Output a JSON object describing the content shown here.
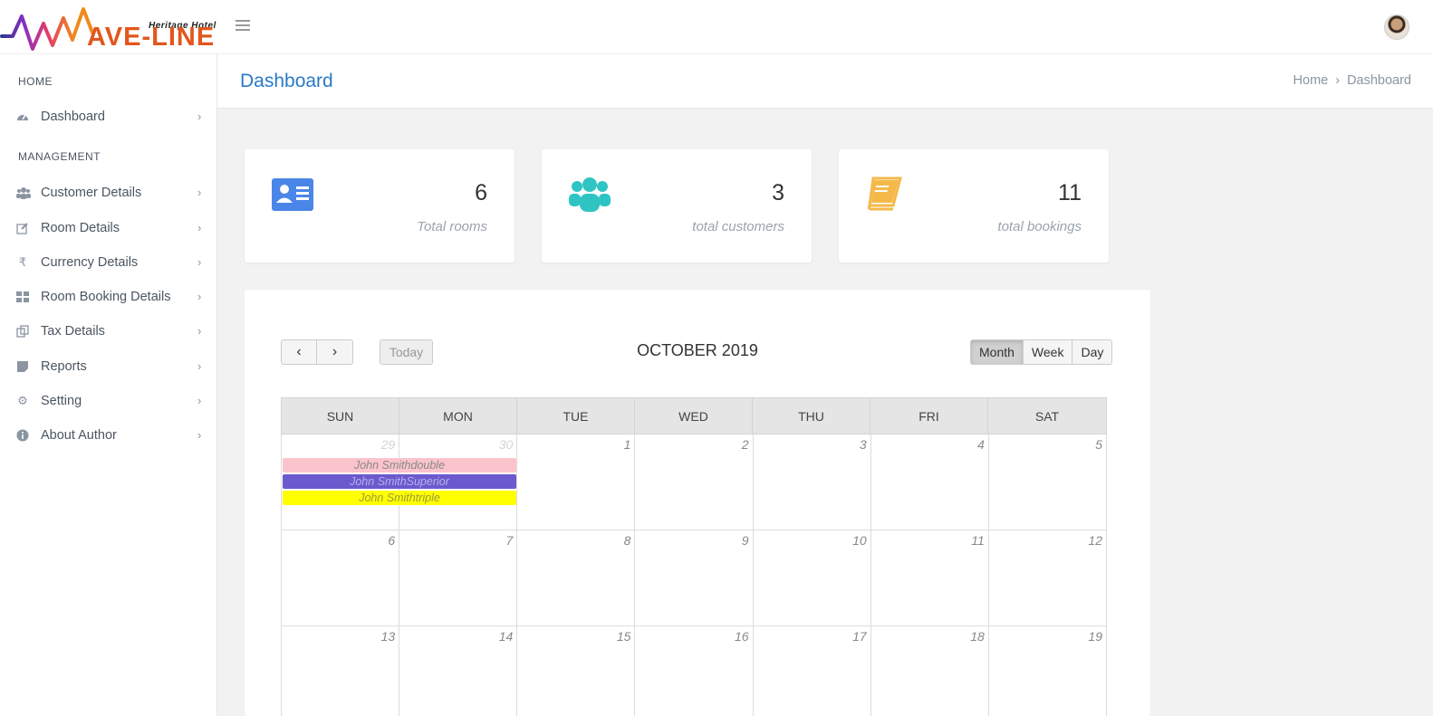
{
  "brand": {
    "name": "AVE-LINE",
    "subtitle": "Heritage Hotel"
  },
  "page": {
    "title": "Dashboard"
  },
  "breadcrumb": {
    "home": "Home",
    "current": "Dashboard"
  },
  "sidebar": {
    "home_heading": "HOME",
    "management_heading": "MANAGEMENT",
    "items": [
      {
        "label": "Dashboard",
        "icon": "dashboard-icon"
      },
      {
        "label": "Customer Details",
        "icon": "users-icon"
      },
      {
        "label": "Room Details",
        "icon": "edit-icon"
      },
      {
        "label": "Currency Details",
        "icon": "rupee-icon"
      },
      {
        "label": "Room Booking Details",
        "icon": "grid-icon"
      },
      {
        "label": "Tax Details",
        "icon": "copy-icon"
      },
      {
        "label": "Reports",
        "icon": "note-icon"
      },
      {
        "label": "Setting",
        "icon": "gear-icon"
      },
      {
        "label": "About Author",
        "icon": "info-icon"
      }
    ]
  },
  "stats": [
    {
      "value": "6",
      "caption": "Total rooms",
      "icon": "id-card-icon",
      "color": "#4a86e8"
    },
    {
      "value": "3",
      "caption": "total customers",
      "icon": "users-icon",
      "color": "#2ec4c4"
    },
    {
      "value": "11",
      "caption": "total bookings",
      "icon": "book-icon",
      "color": "#f5b94a"
    }
  ],
  "calendar": {
    "title": "OCTOBER 2019",
    "today_label": "Today",
    "prev_label": "‹",
    "next_label": "›",
    "views": [
      "Month",
      "Week",
      "Day"
    ],
    "days_of_week": [
      "SUN",
      "MON",
      "TUE",
      "WED",
      "THU",
      "FRI",
      "SAT"
    ],
    "weeks": [
      [
        "29",
        "30",
        "1",
        "2",
        "3",
        "4",
        "5"
      ],
      [
        "6",
        "7",
        "8",
        "9",
        "10",
        "11",
        "12"
      ],
      [
        "13",
        "14",
        "15",
        "16",
        "17",
        "18",
        "19"
      ]
    ],
    "events": [
      {
        "title": "John Smithdouble",
        "color": "#fbc4cc"
      },
      {
        "title": "John SmithSuperior",
        "color": "#6a5acd"
      },
      {
        "title": "John Smithtriple",
        "color": "#ffff00"
      }
    ]
  }
}
